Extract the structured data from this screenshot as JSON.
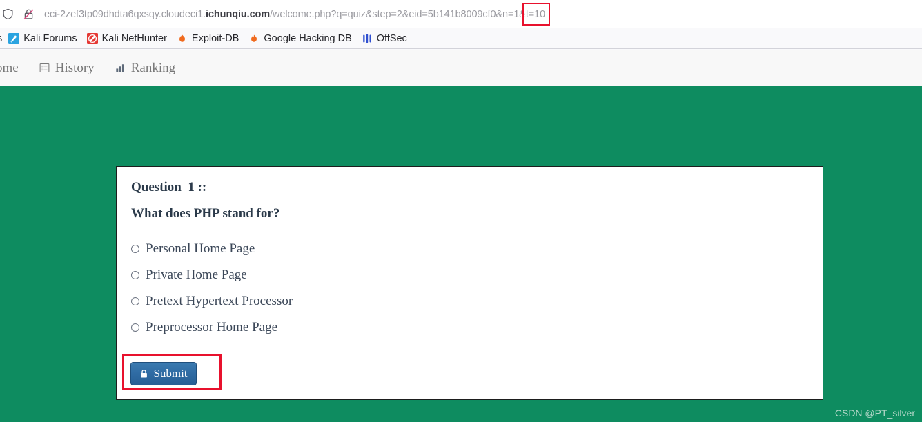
{
  "browser": {
    "url_parts": {
      "subdomain": "eci-2zef3tp09dhdta6qxsqy.cloudeci1.",
      "host": "ichunqiu.com",
      "path_query": "/welcome.php?q=quiz&step=2&eid=5b141b8009cf0&n=1&t=10"
    },
    "full_url": "eci-2zef3tp09dhdta6qxsqy.cloudeci1.ichunqiu.com/welcome.php?q=quiz&step=2&eid=5b141b8009cf0&n=1&t=10",
    "icons": {
      "shield": "shield-icon",
      "connection": "insecure-lock-icon"
    },
    "url_highlight": {
      "text": "&n=1&",
      "color": "#e8112d"
    },
    "bookmarks": {
      "partial_left_label": "s",
      "items": [
        {
          "label": "Kali Forums",
          "icon": "kali-forums-icon"
        },
        {
          "label": "Kali NetHunter",
          "icon": "kali-nethunter-icon"
        },
        {
          "label": "Exploit-DB",
          "icon": "exploit-db-icon"
        },
        {
          "label": "Google Hacking DB",
          "icon": "google-hacking-db-icon"
        },
        {
          "label": "OffSec",
          "icon": "offsec-icon"
        }
      ]
    }
  },
  "site_nav": {
    "items": [
      {
        "label": "ome",
        "icon": "none",
        "name": "nav-home"
      },
      {
        "label": "History",
        "icon": "list-icon",
        "name": "nav-history"
      },
      {
        "label": "Ranking",
        "icon": "bar-chart-icon",
        "name": "nav-ranking"
      }
    ]
  },
  "page": {
    "background_color": "#0e8c60"
  },
  "quiz": {
    "question_label": "Question  1 ::",
    "question_text": "What does PHP stand for?",
    "options": [
      {
        "label": "Personal Home Page",
        "selected": false
      },
      {
        "label": "Private Home Page",
        "selected": false
      },
      {
        "label": "Pretext Hypertext Processor",
        "selected": false
      },
      {
        "label": "Preprocessor Home Page",
        "selected": false
      }
    ],
    "submit": {
      "label": "Submit",
      "icon": "lock-icon",
      "color": "#2f6ba3",
      "highlight_color": "#e8112d"
    }
  },
  "watermark": {
    "text": "CSDN @PT_silver"
  }
}
